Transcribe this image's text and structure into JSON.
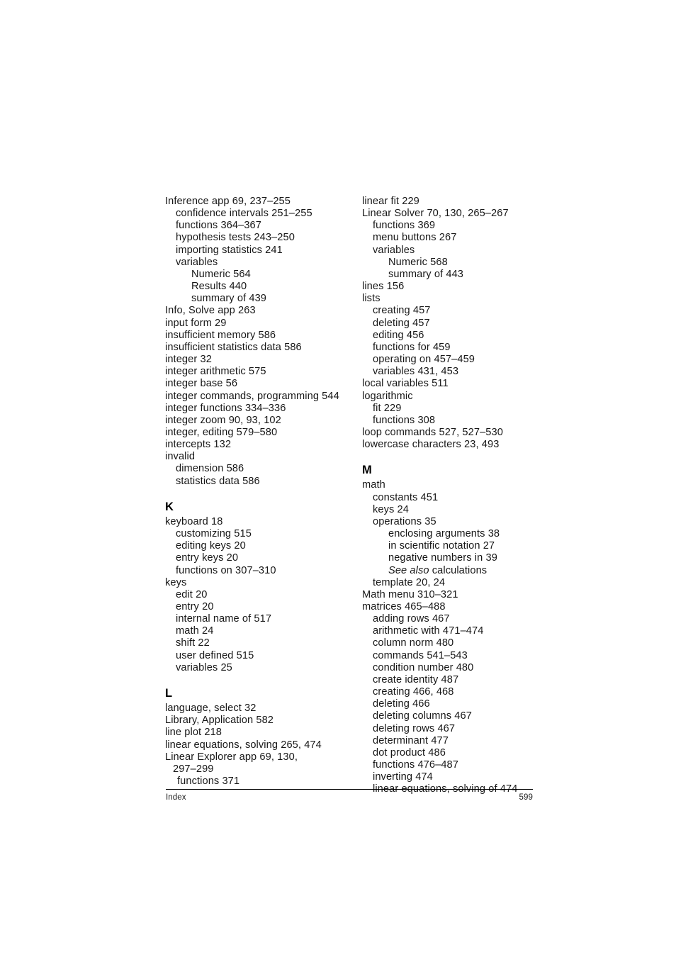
{
  "page": {
    "footer_label": "Index",
    "page_number": "599"
  },
  "columns": [
    {
      "name": "left-column",
      "blocks": [
        {
          "letter": null,
          "entries": [
            {
              "level": 0,
              "text": "Inference app 69, 237–255"
            },
            {
              "level": 1,
              "text": "confidence intervals 251–255"
            },
            {
              "level": 1,
              "text": "functions 364–367"
            },
            {
              "level": 1,
              "text": "hypothesis tests 243–250"
            },
            {
              "level": 1,
              "text": "importing statistics 241"
            },
            {
              "level": 1,
              "text": "variables"
            },
            {
              "level": 2,
              "text": "Numeric 564"
            },
            {
              "level": 2,
              "text": "Results 440"
            },
            {
              "level": 2,
              "text": "summary of 439"
            },
            {
              "level": 0,
              "text": "Info, Solve app 263"
            },
            {
              "level": 0,
              "text": "input form 29"
            },
            {
              "level": 0,
              "text": "insufficient memory 586"
            },
            {
              "level": 0,
              "text": "insufficient statistics data 586"
            },
            {
              "level": 0,
              "text": "integer 32"
            },
            {
              "level": 0,
              "text": "integer arithmetic 575"
            },
            {
              "level": 0,
              "text": "integer base 56"
            },
            {
              "level": 0,
              "text": "integer commands, programming 544"
            },
            {
              "level": 0,
              "text": "integer functions 334–336"
            },
            {
              "level": 0,
              "text": "integer zoom 90, 93, 102"
            },
            {
              "level": 0,
              "text": "integer, editing 579–580"
            },
            {
              "level": 0,
              "text": "intercepts 132"
            },
            {
              "level": 0,
              "text": "invalid"
            },
            {
              "level": 1,
              "text": "dimension 586"
            },
            {
              "level": 1,
              "text": "statistics data 586"
            }
          ]
        },
        {
          "letter": "K",
          "entries": [
            {
              "level": 0,
              "text": "keyboard 18"
            },
            {
              "level": 1,
              "text": "customizing 515"
            },
            {
              "level": 1,
              "text": "editing keys 20"
            },
            {
              "level": 1,
              "text": "entry keys 20"
            },
            {
              "level": 1,
              "text": "functions on 307–310"
            },
            {
              "level": 0,
              "text": "keys"
            },
            {
              "level": 1,
              "text": "edit 20"
            },
            {
              "level": 1,
              "text": "entry 20"
            },
            {
              "level": 1,
              "text": "internal name of 517"
            },
            {
              "level": 1,
              "text": "math 24"
            },
            {
              "level": 1,
              "text": "shift 22"
            },
            {
              "level": 1,
              "text": "user defined 515"
            },
            {
              "level": 1,
              "text": "variables 25"
            }
          ]
        },
        {
          "letter": "L",
          "entries": [
            {
              "level": 0,
              "text": "language, select 32"
            },
            {
              "level": 0,
              "text": "Library, Application 582"
            },
            {
              "level": 0,
              "text": "line plot 218"
            },
            {
              "level": 0,
              "text": "linear equations, solving 265, 474"
            },
            {
              "level": 0,
              "text": "Linear Explorer app 69, 130,"
            },
            {
              "level": "cont",
              "text": "297–299"
            },
            {
              "level": "1b",
              "text": "functions 371"
            }
          ]
        }
      ]
    },
    {
      "name": "right-column",
      "blocks": [
        {
          "letter": null,
          "entries": [
            {
              "level": 0,
              "text": "linear fit 229"
            },
            {
              "level": 0,
              "text": "Linear Solver 70, 130, 265–267"
            },
            {
              "level": 1,
              "text": "functions 369"
            },
            {
              "level": 1,
              "text": "menu buttons 267"
            },
            {
              "level": 1,
              "text": "variables"
            },
            {
              "level": 2,
              "text": "Numeric 568"
            },
            {
              "level": 2,
              "text": "summary of 443"
            },
            {
              "level": 0,
              "text": "lines 156"
            },
            {
              "level": 0,
              "text": "lists"
            },
            {
              "level": 1,
              "text": "creating 457"
            },
            {
              "level": 1,
              "text": "deleting 457"
            },
            {
              "level": 1,
              "text": "editing 456"
            },
            {
              "level": 1,
              "text": "functions for 459"
            },
            {
              "level": 1,
              "text": "operating on 457–459"
            },
            {
              "level": 1,
              "text": "variables 431, 453"
            },
            {
              "level": 0,
              "text": "local variables 511"
            },
            {
              "level": 0,
              "text": "logarithmic"
            },
            {
              "level": 1,
              "text": "fit 229"
            },
            {
              "level": 1,
              "text": "functions 308"
            },
            {
              "level": 0,
              "text": "loop commands 527, 527–530"
            },
            {
              "level": 0,
              "text": "lowercase characters 23, 493"
            }
          ]
        },
        {
          "letter": "M",
          "entries": [
            {
              "level": 0,
              "text": "math"
            },
            {
              "level": 1,
              "text": "constants 451"
            },
            {
              "level": 1,
              "text": "keys 24"
            },
            {
              "level": 1,
              "text": "operations 35"
            },
            {
              "level": 2,
              "text": "enclosing arguments 38"
            },
            {
              "level": 2,
              "text": "in scientific notation 27"
            },
            {
              "level": 2,
              "text": "negative numbers in 39"
            },
            {
              "level": 2,
              "text": "See also calculations",
              "italic_prefix": "See also",
              "roman_suffix": " calculations"
            },
            {
              "level": 1,
              "text": "template 20, 24"
            },
            {
              "level": 0,
              "text": "Math menu 310–321"
            },
            {
              "level": 0,
              "text": "matrices 465–488"
            },
            {
              "level": 1,
              "text": "adding rows 467"
            },
            {
              "level": 1,
              "text": "arithmetic with 471–474"
            },
            {
              "level": 1,
              "text": "column norm 480"
            },
            {
              "level": 1,
              "text": "commands 541–543"
            },
            {
              "level": 1,
              "text": "condition number 480"
            },
            {
              "level": 1,
              "text": "create identity 487"
            },
            {
              "level": 1,
              "text": "creating 466, 468"
            },
            {
              "level": 1,
              "text": "deleting 466"
            },
            {
              "level": 1,
              "text": "deleting columns 467"
            },
            {
              "level": 1,
              "text": "deleting rows 467"
            },
            {
              "level": 1,
              "text": "determinant 477"
            },
            {
              "level": 1,
              "text": "dot product 486"
            },
            {
              "level": 1,
              "text": "functions 476–487"
            },
            {
              "level": 1,
              "text": "inverting 474"
            },
            {
              "level": 1,
              "text": "linear equations, solving of 474"
            }
          ]
        }
      ]
    }
  ]
}
